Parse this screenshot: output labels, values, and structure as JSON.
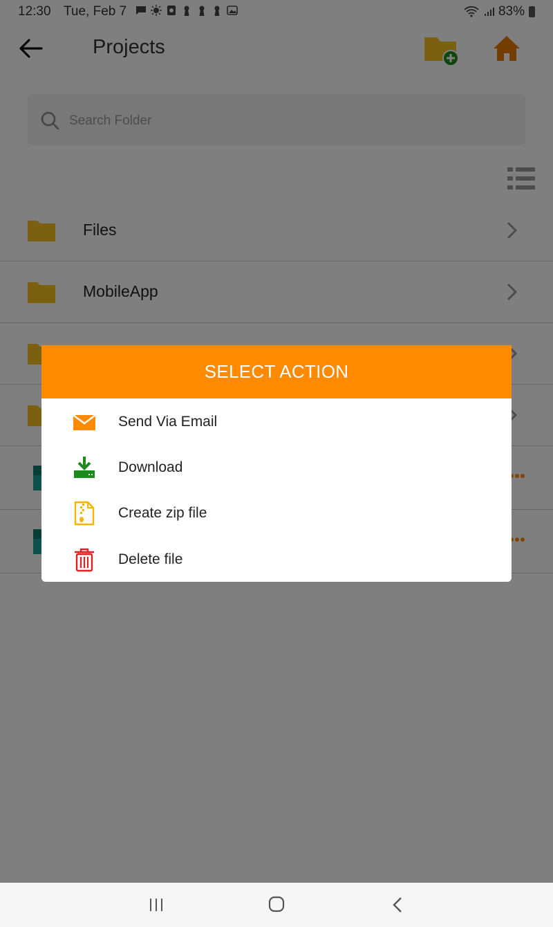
{
  "status_bar": {
    "time": "12:30",
    "date": "Tue, Feb 7",
    "battery": "83%",
    "notification_icons": [
      "message-icon",
      "sun-icon",
      "screen-recorder-icon",
      "keyhole-icon",
      "keyhole-icon",
      "keyhole-icon",
      "image-icon"
    ]
  },
  "header": {
    "title": "Projects"
  },
  "search": {
    "placeholder": "Search Folder",
    "value": ""
  },
  "folders": [
    {
      "name": "Files"
    },
    {
      "name": "MobileApp"
    }
  ],
  "dialog": {
    "title": "SELECT ACTION",
    "actions": [
      {
        "label": "Send Via Email",
        "icon": "envelope-icon"
      },
      {
        "label": "Download",
        "icon": "download-icon"
      },
      {
        "label": "Create zip file",
        "icon": "zip-file-icon"
      },
      {
        "label": "Delete file",
        "icon": "trash-icon"
      }
    ]
  },
  "colors": {
    "accent": "#ff8a00",
    "folder": "#f5c021",
    "download": "#1e8a1e",
    "delete": "#e02020",
    "home": "#e87a00"
  }
}
